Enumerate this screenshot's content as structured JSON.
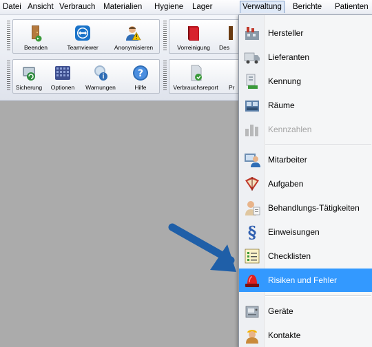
{
  "menubar": {
    "items": [
      "Datei",
      "Ansicht",
      "Verbrauch",
      "Materialien",
      "Hygiene",
      "Lager",
      "Verwaltung",
      "Berichte",
      "Patienten"
    ],
    "active": "Verwaltung"
  },
  "toolbar": {
    "row1": [
      "Beenden",
      "Teamviewer",
      "Anonymisieren",
      "Vorreinigung",
      "Des"
    ],
    "row2": [
      "Sicherung",
      "Optionen",
      "Warnungen",
      "Hilfe",
      "Verbrauchsreport",
      "Pr"
    ]
  },
  "dropdown": {
    "items": [
      {
        "label": "Hersteller",
        "icon": "factory-icon"
      },
      {
        "label": "Lieferanten",
        "icon": "truck-icon"
      },
      {
        "label": "Kennung",
        "icon": "id-stack-icon"
      },
      {
        "label": "Räume",
        "icon": "rooms-icon"
      },
      {
        "label": "Kennzahlen",
        "icon": "bar-chart-icon",
        "disabled": true
      },
      {
        "label": "Mitarbeiter",
        "icon": "employee-icon"
      },
      {
        "label": "Aufgaben",
        "icon": "book-icon"
      },
      {
        "label": "Behandlungs-Tätigkeiten",
        "icon": "person-document-icon"
      },
      {
        "label": "Einweisungen",
        "icon": "paragraph-icon"
      },
      {
        "label": "Checklisten",
        "icon": "checklist-icon"
      },
      {
        "label": "Risiken und Fehler",
        "icon": "alarm-light-icon",
        "highlighted": true
      },
      {
        "label": "Geräte",
        "icon": "device-icon"
      },
      {
        "label": "Kontakte",
        "icon": "contact-icon"
      }
    ]
  },
  "annotation": {
    "icon": "pointer-arrow-icon",
    "color": "#1f5fa8"
  },
  "colors": {
    "highlight": "#3399ff",
    "menu_bg": "#f5f6f7",
    "content_bg": "#ababab"
  }
}
